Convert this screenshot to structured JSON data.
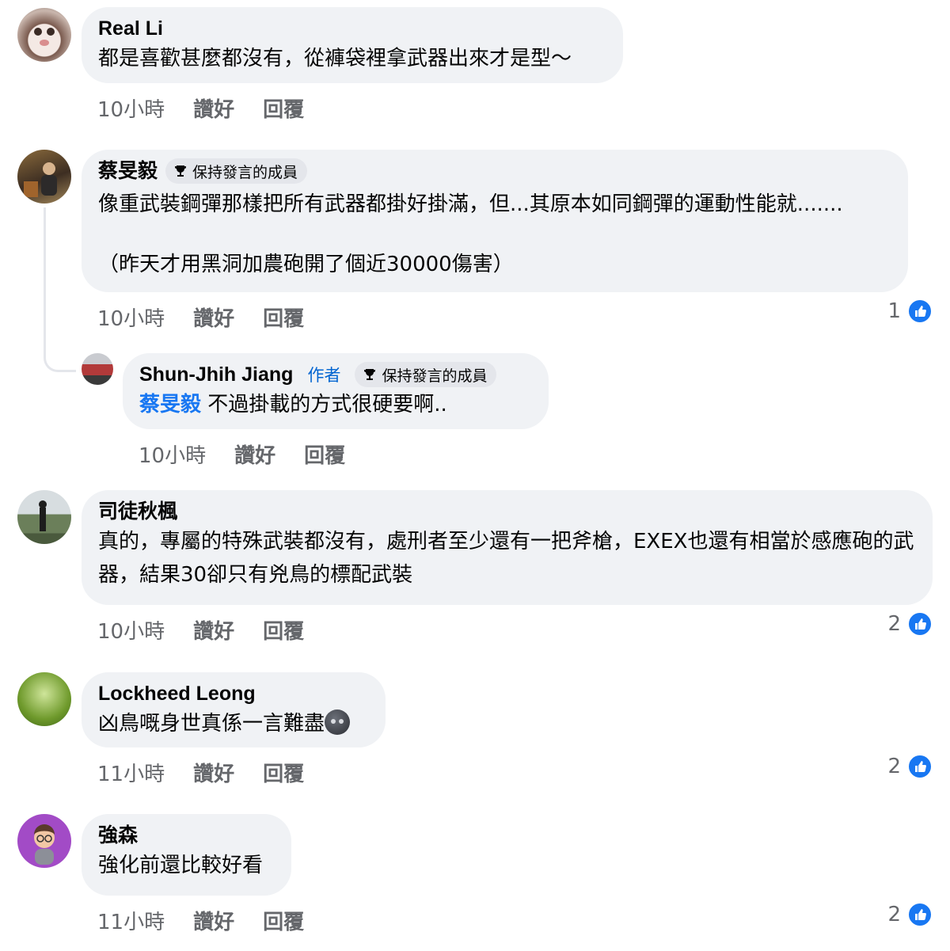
{
  "actions": {
    "like_label": "讚好",
    "reply_label": "回覆"
  },
  "comments": [
    {
      "name": "Real Li",
      "text": "都是喜歡甚麼都沒有，從褲袋裡拿武器出來才是型～",
      "time": "10小時"
    },
    {
      "name": "蔡旻毅",
      "badge": "保持發言的成員",
      "text": "像重武裝鋼彈那樣把所有武器都掛好掛滿，但...其原本如同鋼彈的運動性能就.......",
      "text2": "（昨天才用黑洞加農砲開了個近30000傷害）",
      "time": "10小時",
      "likes": "1"
    },
    {
      "name": "Shun-Jhih Jiang",
      "author_tag": "作者",
      "badge": "保持發言的成員",
      "mention": "蔡旻毅",
      "text": "不過掛載的方式很硬要啊..",
      "time": "10小時"
    },
    {
      "name": "司徒秋楓",
      "text": "真的，專屬的特殊武裝都沒有，處刑者至少還有一把斧槍，EXEX也還有相當於感應砲的武器，結果30卻只有兇鳥的標配武裝",
      "time": "10小時",
      "likes": "2"
    },
    {
      "name": "Lockheed Leong",
      "text": "凶鳥嘅身世真係一言難盡",
      "time": "11小時",
      "likes": "2"
    },
    {
      "name": "強森",
      "text": "強化前還比較好看",
      "time": "11小時",
      "likes": "2"
    }
  ],
  "colors": {
    "bubble": "#f0f2f5",
    "accent": "#1877f2",
    "meta": "#65676b"
  }
}
